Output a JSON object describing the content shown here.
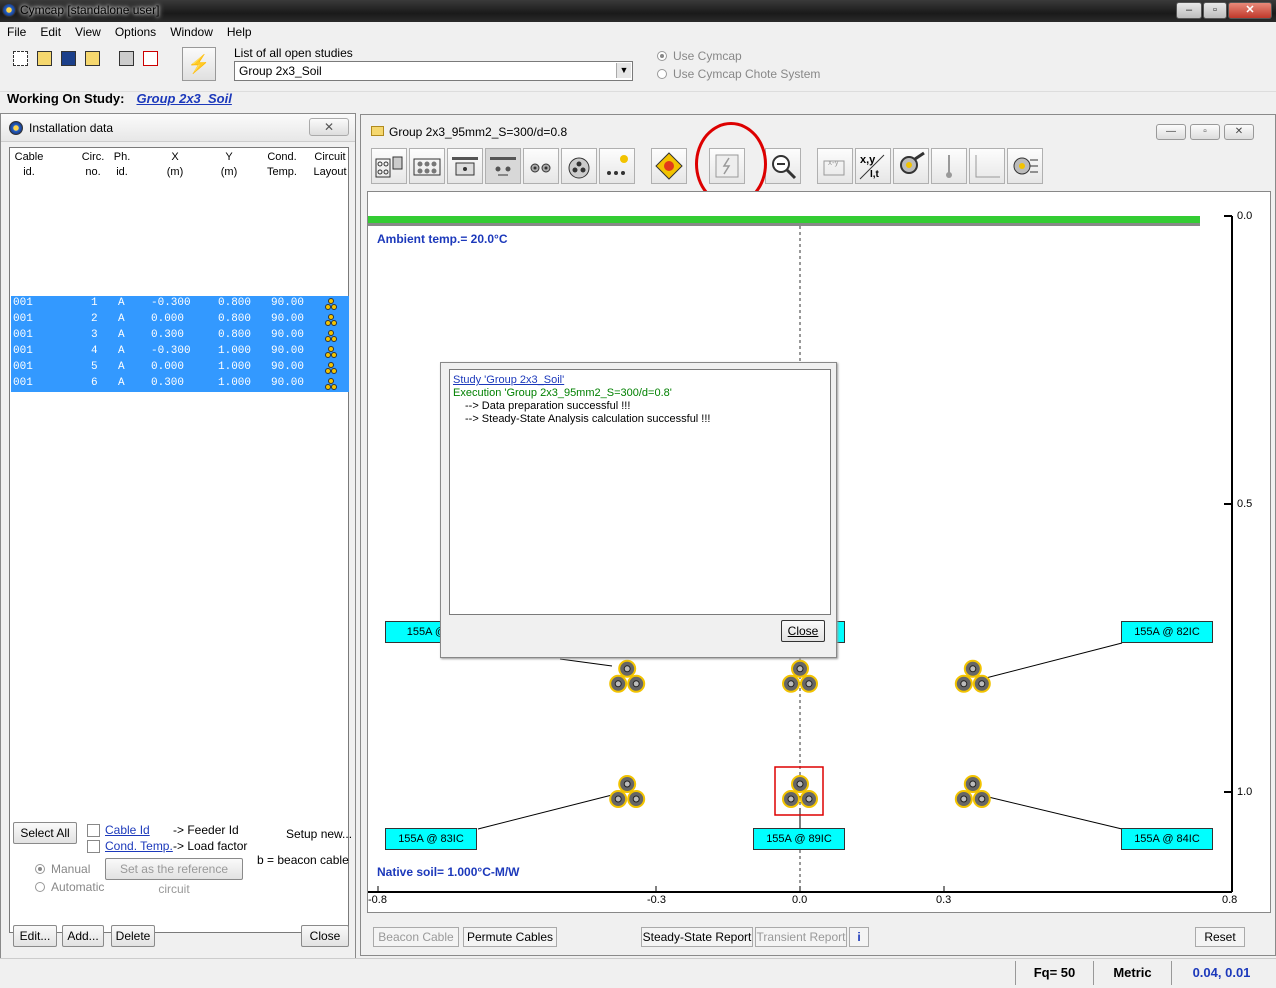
{
  "window": {
    "title": "Cymcap [standalone user]",
    "buttons": [
      "–",
      "▫",
      "✕"
    ]
  },
  "menu": [
    "File",
    "Edit",
    "View",
    "Options",
    "Window",
    "Help"
  ],
  "toolbar": {
    "studies_label": "List of all open studies",
    "studies_value": "Group 2x3_Soil",
    "radio_cymcap": "Use Cymcap",
    "radio_chote": "Use Cymcap Chote System"
  },
  "working": {
    "label": "Working On Study:",
    "study": "Group 2x3_Soil"
  },
  "installation": {
    "title": "Installation data",
    "close_x": "✕",
    "headers": [
      {
        "l1": "Cable",
        "l2": "id."
      },
      {
        "l1": "Circ.",
        "l2": "no."
      },
      {
        "l1": "Ph.",
        "l2": "id."
      },
      {
        "l1": "X",
        "l2": "(m)"
      },
      {
        "l1": "Y",
        "l2": "(m)"
      },
      {
        "l1": "Cond.",
        "l2": "Temp."
      },
      {
        "l1": "Circuit",
        "l2": "Layout"
      }
    ],
    "rows": [
      {
        "cable": "001",
        "circ": "1",
        "ph": "A",
        "x": "-0.300",
        "y": "0.800",
        "temp": "90.00"
      },
      {
        "cable": "001",
        "circ": "2",
        "ph": "A",
        "x": "0.000",
        "y": "0.800",
        "temp": "90.00"
      },
      {
        "cable": "001",
        "circ": "3",
        "ph": "A",
        "x": "0.300",
        "y": "0.800",
        "temp": "90.00"
      },
      {
        "cable": "001",
        "circ": "4",
        "ph": "A",
        "x": "-0.300",
        "y": "1.000",
        "temp": "90.00"
      },
      {
        "cable": "001",
        "circ": "5",
        "ph": "A",
        "x": "0.000",
        "y": "1.000",
        "temp": "90.00"
      },
      {
        "cable": "001",
        "circ": "6",
        "ph": "A",
        "x": "0.300",
        "y": "1.000",
        "temp": "90.00"
      }
    ],
    "select_all": "Select All",
    "cable_id": "Cable Id",
    "feeder_id": "-> Feeder Id",
    "cond_temp": "Cond. Temp.",
    "load_factor": "-> Load factor",
    "setup_new": "Setup new...",
    "beacon_note": "b = beacon cable",
    "manual": "Manual",
    "automatic": "Automatic",
    "set_reference": "Set as the reference circuit",
    "edit": "Edit...",
    "add": "Add...",
    "delete": "Delete",
    "close": "Close"
  },
  "drawing": {
    "title": "Group 2x3_95mm2_S=300/d=0.8",
    "ambient": "Ambient temp.= 20.0°C",
    "native_soil": "Native soil= 1.000°C-M/W",
    "x_ticks": [
      "-0.8",
      "-0.3",
      "0.0",
      "0.3",
      "0.8"
    ],
    "y_ticks": [
      "0.0",
      "0.5",
      "1.0"
    ],
    "labels": [
      {
        "text": "155A @ 8",
        "pos": "top-left"
      },
      {
        "text": "",
        "pos": "top-center"
      },
      {
        "text": "155A @ 82IC",
        "pos": "top-right"
      },
      {
        "text": "155A @ 83IC",
        "pos": "bottom-left"
      },
      {
        "text": "155A @ 89IC",
        "pos": "bottom-center"
      },
      {
        "text": "155A @ 84IC",
        "pos": "bottom-right"
      }
    ],
    "tabs": [
      "Beacon Cable",
      "Permute Cables",
      "Steady-State Report",
      "Transient Report",
      "Reset"
    ]
  },
  "dialog": {
    "line1": "Study 'Group 2x3_Soil'",
    "line2": "Execution 'Group 2x3_95mm2_S=300/d=0.8'",
    "line3": "--> Data preparation successful !!!",
    "line4": "--> Steady-State Analysis calculation successful !!!",
    "close": "Close"
  },
  "status": {
    "fq": "Fq= 50",
    "units": "Metric",
    "coords": "0.04, 0.01"
  },
  "colors": {
    "selection": "#3399ff",
    "label_bg": "#00ffff",
    "ground": "#33cc33",
    "text_blue": "#1c39bb",
    "highlight_red": "#dd0000"
  }
}
